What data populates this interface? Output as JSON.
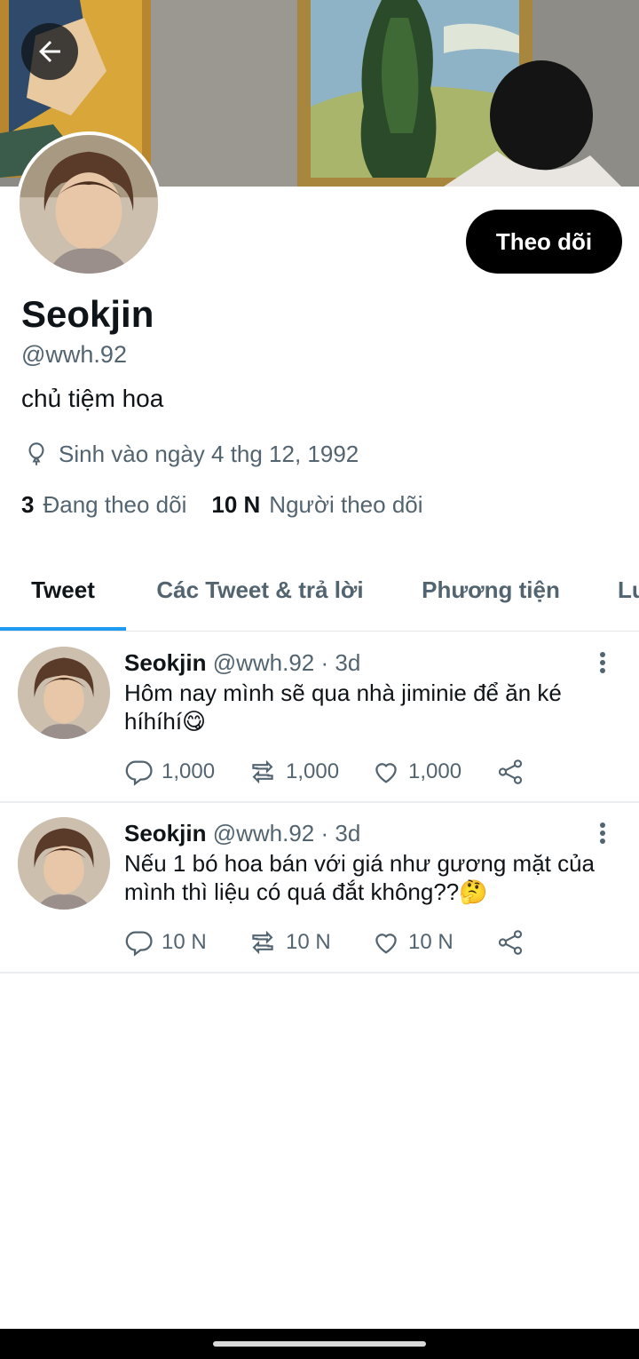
{
  "header": {
    "back_icon": "arrow-left-icon",
    "follow_label": "Theo dõi"
  },
  "profile": {
    "name": "Seokjin",
    "handle": "@wwh.92",
    "bio": "chủ tiệm hoa",
    "birthday_icon": "balloon-icon",
    "birthday": "Sinh vào ngày 4 thg 12, 1992",
    "following_count": "3",
    "following_label": "Đang theo dõi",
    "followers_count": "10 N",
    "followers_label": "Người theo dõi"
  },
  "tabs": [
    {
      "label": "Tweet",
      "active": true
    },
    {
      "label": "Các Tweet & trả lời",
      "active": false
    },
    {
      "label": "Phương tiện",
      "active": false
    },
    {
      "label": "Lu",
      "active": false
    }
  ],
  "colors": {
    "accent": "#1d9bf0",
    "text": "#0f1419",
    "muted": "#536471",
    "button_bg": "#000000"
  },
  "tweets": [
    {
      "name": "Seokjin",
      "meta": "@wwh.92 · 3d",
      "text": "Hôm nay mình sẽ qua nhà jiminie để ăn ké híhíhí😋",
      "replies": "1,000",
      "retweets": "1,000",
      "likes": "1,000"
    },
    {
      "name": "Seokjin",
      "meta": "@wwh.92 · 3d",
      "text": "Nếu 1 bó hoa bán với giá như gương mặt của mình thì liệu có quá đắt không??🤔",
      "replies": "10 N",
      "retweets": "10 N",
      "likes": "10 N"
    }
  ]
}
